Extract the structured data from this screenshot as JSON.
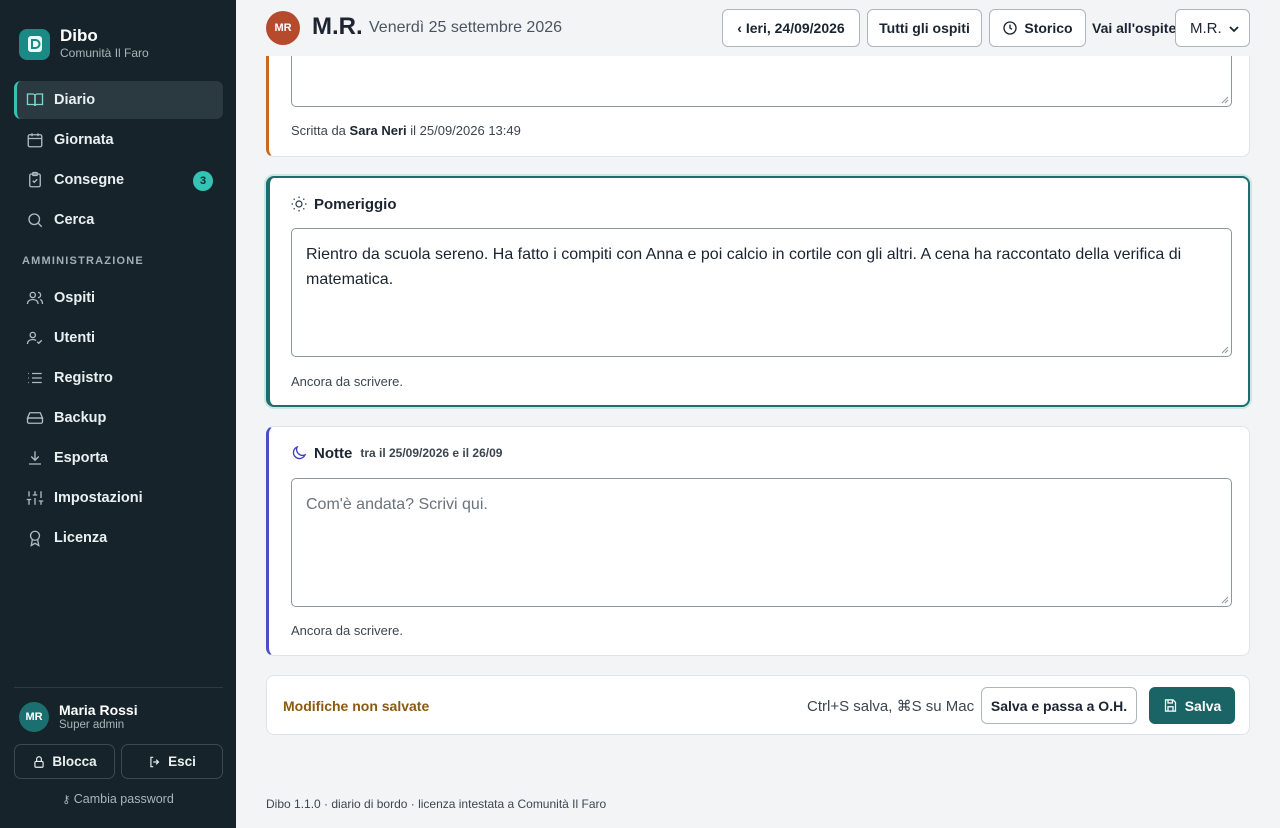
{
  "brand": {
    "name": "Dibo",
    "subtitle": "Comunità Il Faro"
  },
  "nav": {
    "items": [
      {
        "label": "Diario",
        "icon": "book-icon",
        "active": true
      },
      {
        "label": "Giornata",
        "icon": "calendar-icon"
      },
      {
        "label": "Consegne",
        "icon": "clipboard-icon",
        "badge": "3"
      },
      {
        "label": "Cerca",
        "icon": "search-icon"
      }
    ],
    "section_label": "AMMINISTRAZIONE",
    "admin_items": [
      {
        "label": "Ospiti",
        "icon": "users-icon"
      },
      {
        "label": "Utenti",
        "icon": "user-check-icon"
      },
      {
        "label": "Registro",
        "icon": "list-icon"
      },
      {
        "label": "Backup",
        "icon": "hard-drive-icon"
      },
      {
        "label": "Esporta",
        "icon": "download-icon"
      },
      {
        "label": "Impostazioni",
        "icon": "sliders-icon"
      },
      {
        "label": "Licenza",
        "icon": "award-icon"
      }
    ]
  },
  "user": {
    "initials": "MR",
    "name": "Maria Rossi",
    "role": "Super admin"
  },
  "sidebar_actions": {
    "lock": "Blocca",
    "logout": "Esci",
    "change_password": "Cambia password"
  },
  "header": {
    "guest_initials": "MR",
    "guest_name": "M.R.",
    "date": "Venerdì 25 settembre 2026",
    "prev_day": "‹ Ieri, 24/09/2026",
    "all_guests": "Tutti gli ospiti",
    "history": "Storico",
    "goto_label": "Vai all'ospite",
    "goto_selected": "M.R."
  },
  "entries": {
    "morning": {
      "written_prefix": "Scritta da",
      "author": "Sara Neri",
      "written_suffix": "il 25/09/2026 13:49",
      "accent": "#c56a1f"
    },
    "afternoon": {
      "title": "Pomeriggio",
      "text": "Rientro da scuola sereno. Ha fatto i compiti con Anna e poi calcio in cortile con gli altri. A cena ha raccontato della verifica di matematica.",
      "status": "Ancora da scrivere.",
      "accent": "#1a6e6b"
    },
    "night": {
      "title": "Notte",
      "subtitle": "tra il 25/09/2026 e il 26/09",
      "placeholder": "Com'è andata? Scrivi qui.",
      "status": "Ancora da scrivere.",
      "accent": "#4a4fc9"
    }
  },
  "savebar": {
    "unsaved": "Modifiche non salvate",
    "shortcut": "Ctrl+S salva, ⌘S su Mac",
    "save_and_next": "Salva e passa a O.H.",
    "save": "Salva"
  },
  "footer": "Dibo 1.1.0 · diario di bordo · licenza intestata a Comunità Il Faro"
}
